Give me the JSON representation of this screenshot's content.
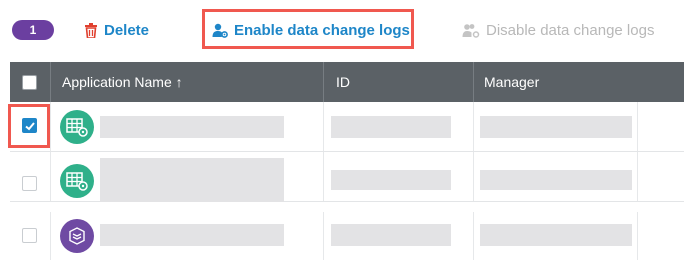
{
  "toolbar": {
    "selected_count": "1",
    "delete_label": "Delete",
    "enable_label": "Enable data change logs",
    "disable_label": "Disable data change logs",
    "delete_icon": "trash-icon",
    "enable_icon": "user-gear-icon",
    "disable_icon": "users-gear-icon"
  },
  "table": {
    "columns": [
      "Application Name ↑",
      "ID",
      "Manager"
    ],
    "sort_indicator": "ascending",
    "rows": [
      {
        "checked": true,
        "icon": "spreadsheet-gear-icon",
        "icon_color": "#2fb08a"
      },
      {
        "checked": false,
        "icon": "spreadsheet-gear-icon",
        "icon_color": "#2fb08a"
      },
      {
        "checked": false,
        "icon": "stack-layers-icon",
        "icon_color": "#6f4aa3"
      }
    ]
  },
  "colors": {
    "accent": "#1e86c8",
    "badge": "#6b3fa0",
    "header_bg": "#5b6166",
    "highlight": "#f0584f",
    "disabled_text": "#b8b8b8"
  }
}
